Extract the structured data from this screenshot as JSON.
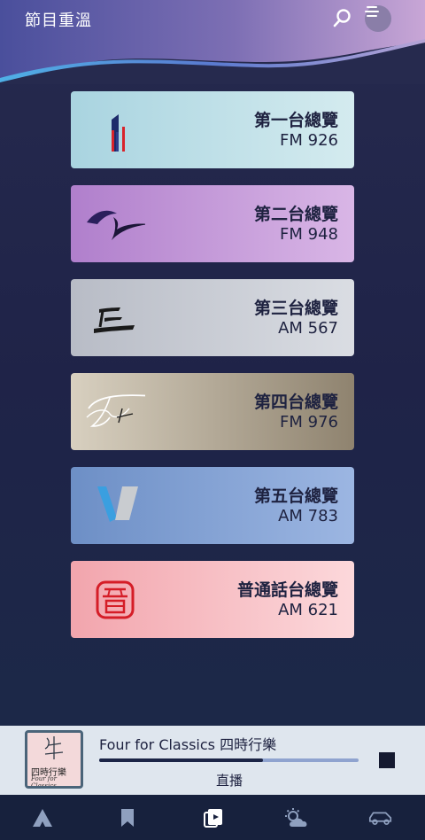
{
  "header": {
    "title": "節目重溫",
    "search_icon": "search-icon",
    "menu_icon": "menu-icon"
  },
  "channels": [
    {
      "name": "第一台總覽",
      "frequency": "FM 926",
      "icon": "radio1-logo-icon",
      "gradient": [
        "#a9d4e0",
        "#d4ebef"
      ]
    },
    {
      "name": "第二台總覽",
      "frequency": "FM 948",
      "icon": "radio2-logo-icon",
      "gradient": [
        "#b07fcc",
        "#d9b6e6"
      ]
    },
    {
      "name": "第三台總覽",
      "frequency": "AM 567",
      "icon": "radio3-logo-icon",
      "gradient": [
        "#b8bcc6",
        "#dadde3"
      ]
    },
    {
      "name": "第四台總覽",
      "frequency": "FM 976",
      "icon": "radio4-logo-icon",
      "gradient": [
        "#d8d0c0",
        "#8f836f"
      ]
    },
    {
      "name": "第五台總覽",
      "frequency": "AM 783",
      "icon": "radio5-logo-icon",
      "gradient": [
        "#6d8fc6",
        "#9cb6e2"
      ]
    },
    {
      "name": "普通話台總覽",
      "frequency": "AM 621",
      "icon": "putonghua-logo-icon",
      "gradient": [
        "#f2a5ad",
        "#fcd8db"
      ]
    }
  ],
  "player": {
    "cover_text_cn": "四時行樂",
    "cover_text_en": "Four for Classics",
    "track_title": "Four for Classics 四時行樂",
    "progress": 0.63,
    "status": "直播",
    "stop_icon": "stop-icon"
  },
  "bottom_nav": [
    {
      "icon": "home-icon"
    },
    {
      "icon": "bookmark-icon"
    },
    {
      "icon": "playlist-video-icon"
    },
    {
      "icon": "weather-icon"
    },
    {
      "icon": "car-icon"
    }
  ],
  "colors": {
    "background": "#1f2348",
    "card_text": "#1e2240",
    "player_bg": "#dfe6ee",
    "nav_bg": "#17213d",
    "stop": "#151a30"
  }
}
